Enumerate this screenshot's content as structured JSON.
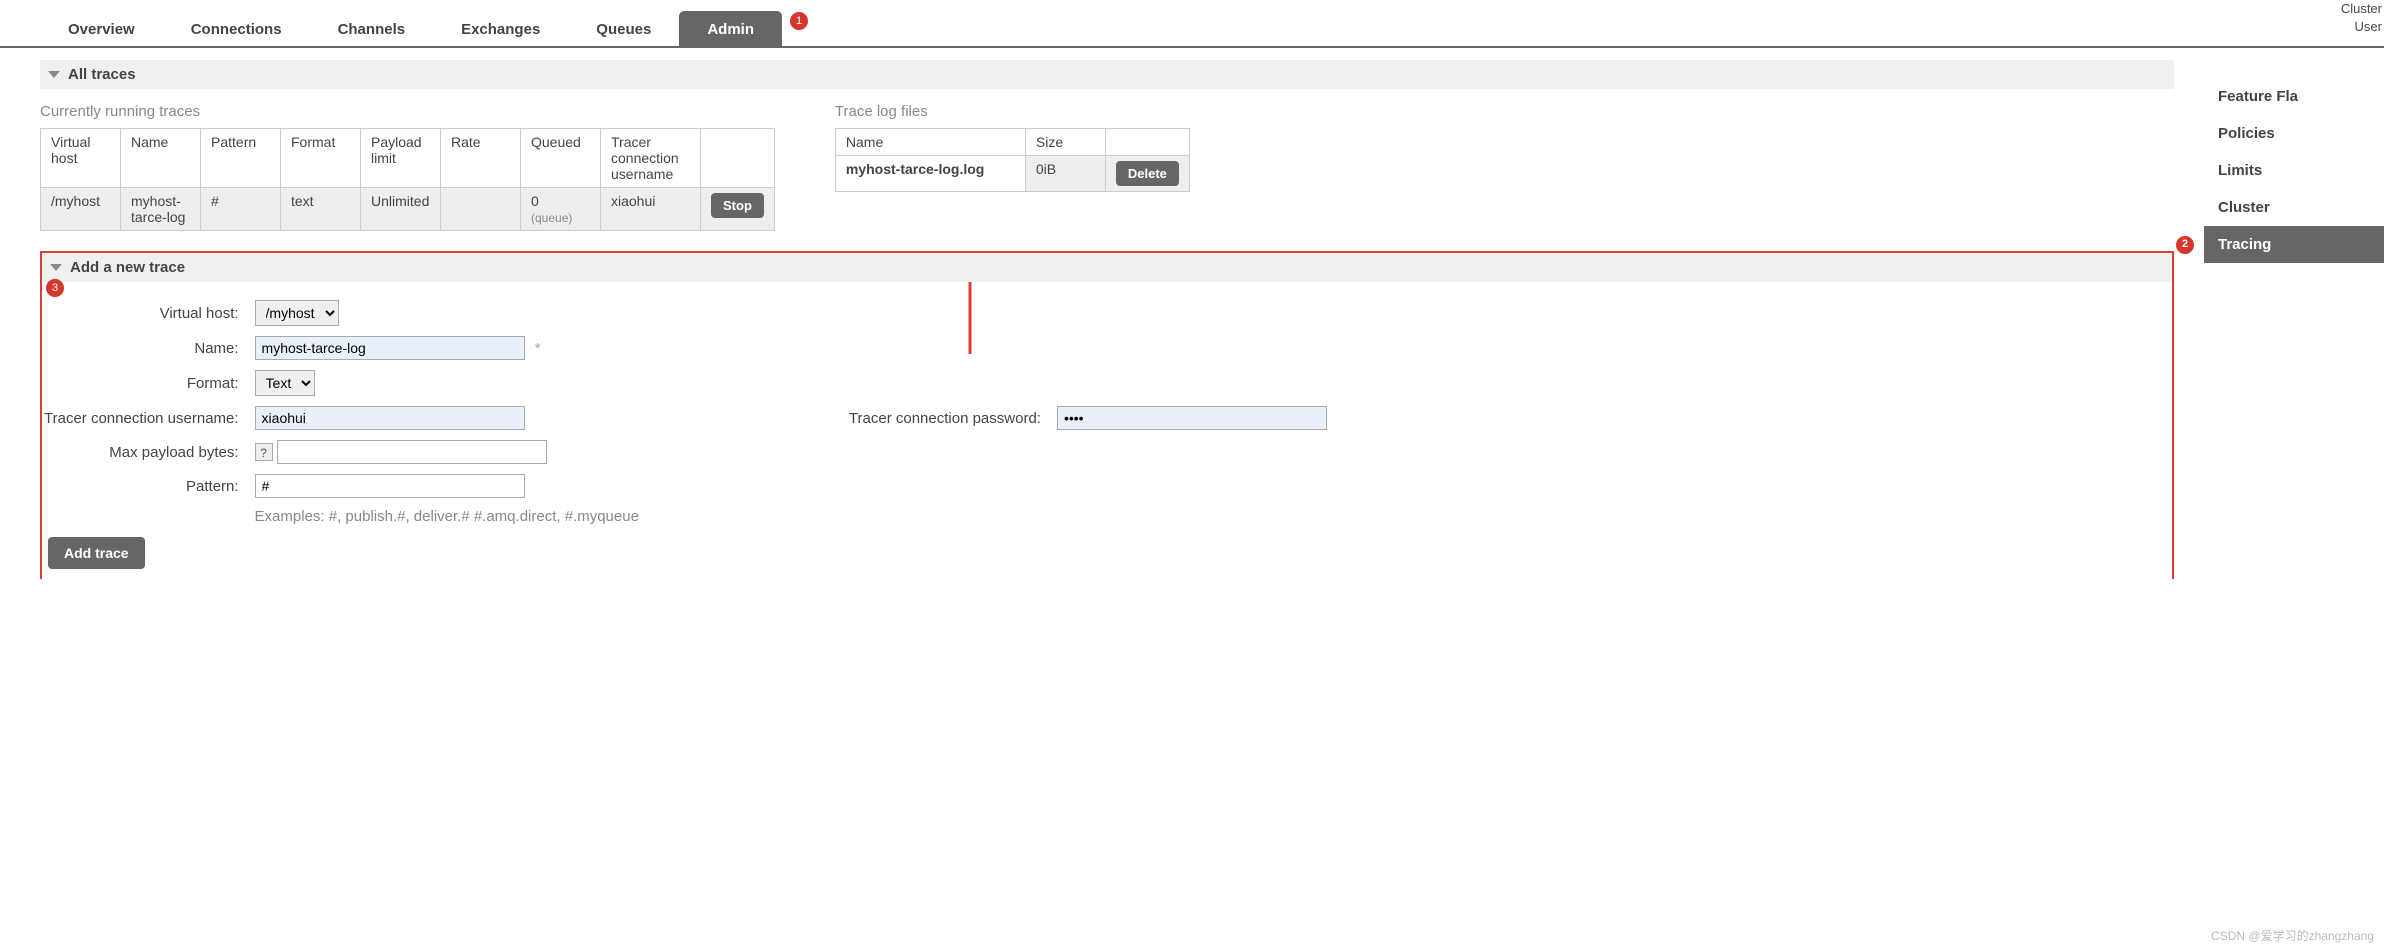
{
  "header": {
    "cluster_label": "Cluster",
    "user_label": "User"
  },
  "nav": {
    "overview": "Overview",
    "connections": "Connections",
    "channels": "Channels",
    "exchanges": "Exchanges",
    "queues": "Queues",
    "admin": "Admin"
  },
  "badges": {
    "b1": "1",
    "b2": "2",
    "b3": "3"
  },
  "sidebar": {
    "feature_flags": "Feature Fla",
    "policies": "Policies",
    "limits": "Limits",
    "cluster": "Cluster",
    "tracing": "Tracing"
  },
  "sections": {
    "all_traces": "All traces",
    "add_trace": "Add a new trace"
  },
  "running": {
    "title": "Currently running traces",
    "cols": {
      "vhost": "Virtual host",
      "name": "Name",
      "pattern": "Pattern",
      "format": "Format",
      "payload": "Payload limit",
      "rate": "Rate",
      "queued": "Queued",
      "tracer_user": "Tracer connection username"
    },
    "row": {
      "vhost": "/myhost",
      "name": "myhost-tarce-log",
      "pattern": "#",
      "format": "text",
      "payload": "Unlimited",
      "rate": "",
      "queued": "0",
      "queued_sub": "(queue)",
      "tracer_user": "xiaohui",
      "stop": "Stop"
    }
  },
  "logs": {
    "title": "Trace log files",
    "cols": {
      "name": "Name",
      "size": "Size"
    },
    "row": {
      "name": "myhost-tarce-log.log",
      "size": "0iB",
      "delete": "Delete"
    }
  },
  "form": {
    "labels": {
      "vhost": "Virtual host:",
      "name": "Name:",
      "format": "Format:",
      "tracer_user": "Tracer connection username:",
      "tracer_pass": "Tracer connection password:",
      "max_payload": "Max payload bytes:",
      "pattern": "Pattern:"
    },
    "values": {
      "vhost": "/myhost",
      "name": "myhost-tarce-log",
      "format": "Text",
      "tracer_user": "xiaohui",
      "tracer_pass": "••••",
      "max_payload": "",
      "pattern": "#"
    },
    "examples": "Examples: #, publish.#, deliver.# #.amq.direct, #.myqueue",
    "submit": "Add trace",
    "help": "?",
    "mandatory": "*"
  },
  "watermark": "CSDN @爱学习的zhangzhang"
}
